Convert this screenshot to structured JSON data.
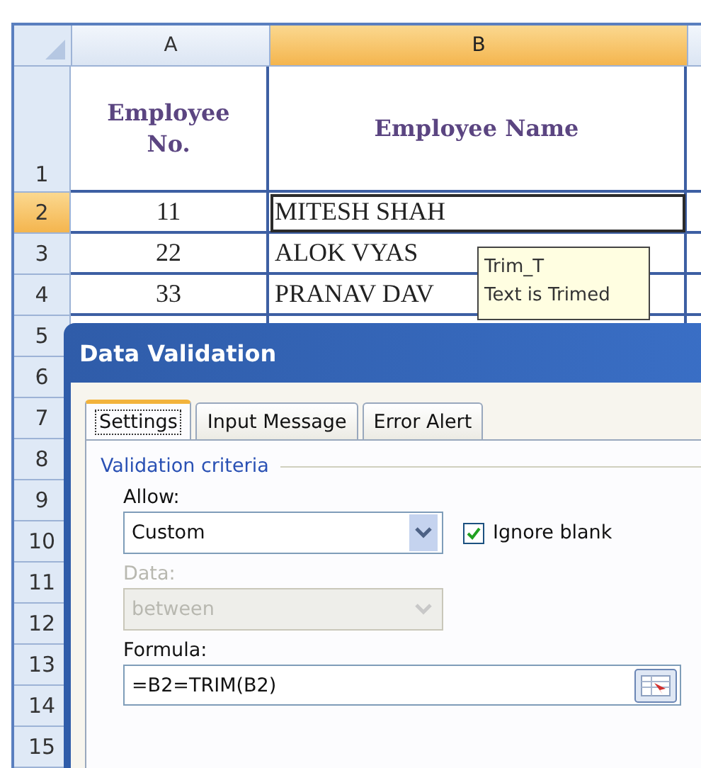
{
  "spreadsheet": {
    "columns": [
      {
        "label": "A",
        "selected": false
      },
      {
        "label": "B",
        "selected": true
      }
    ],
    "rows": [
      {
        "number": "1",
        "selected": false,
        "kind": "header",
        "cells": [
          "Employee No.",
          "Employee Name"
        ]
      },
      {
        "number": "2",
        "selected": true,
        "kind": "data",
        "cells": [
          "11",
          "MITESH SHAH"
        ]
      },
      {
        "number": "3",
        "selected": false,
        "kind": "data",
        "cells": [
          "22",
          "ALOK VYAS"
        ]
      },
      {
        "number": "4",
        "selected": false,
        "kind": "data",
        "cells": [
          "33",
          "PRANAV DAV"
        ]
      },
      {
        "number": "5",
        "selected": false,
        "kind": "blank"
      },
      {
        "number": "6",
        "selected": false,
        "kind": "blank"
      },
      {
        "number": "7",
        "selected": false,
        "kind": "blank"
      },
      {
        "number": "8",
        "selected": false,
        "kind": "blank"
      },
      {
        "number": "9",
        "selected": false,
        "kind": "blank"
      },
      {
        "number": "10",
        "selected": false,
        "kind": "blank"
      },
      {
        "number": "11",
        "selected": false,
        "kind": "blank"
      },
      {
        "number": "12",
        "selected": false,
        "kind": "blank"
      },
      {
        "number": "13",
        "selected": false,
        "kind": "blank"
      },
      {
        "number": "14",
        "selected": false,
        "kind": "blank"
      },
      {
        "number": "15",
        "selected": false,
        "kind": "blank"
      }
    ]
  },
  "tooltip": {
    "title": "Trim_T",
    "text": "Text is Trimed"
  },
  "dialog": {
    "title": "Data Validation",
    "tabs": [
      {
        "label": "Settings",
        "selected": true
      },
      {
        "label": "Input Message",
        "selected": false
      },
      {
        "label": "Error Alert",
        "selected": false
      }
    ],
    "section": "Validation criteria",
    "allow": {
      "label": "Allow:",
      "value": "Custom",
      "disabled": false
    },
    "ignore_blank": {
      "label": "Ignore blank",
      "checked": true
    },
    "data": {
      "label": "Data:",
      "value": "between",
      "disabled": true
    },
    "formula": {
      "label": "Formula:",
      "value": "=B2=TRIM(B2)"
    }
  }
}
